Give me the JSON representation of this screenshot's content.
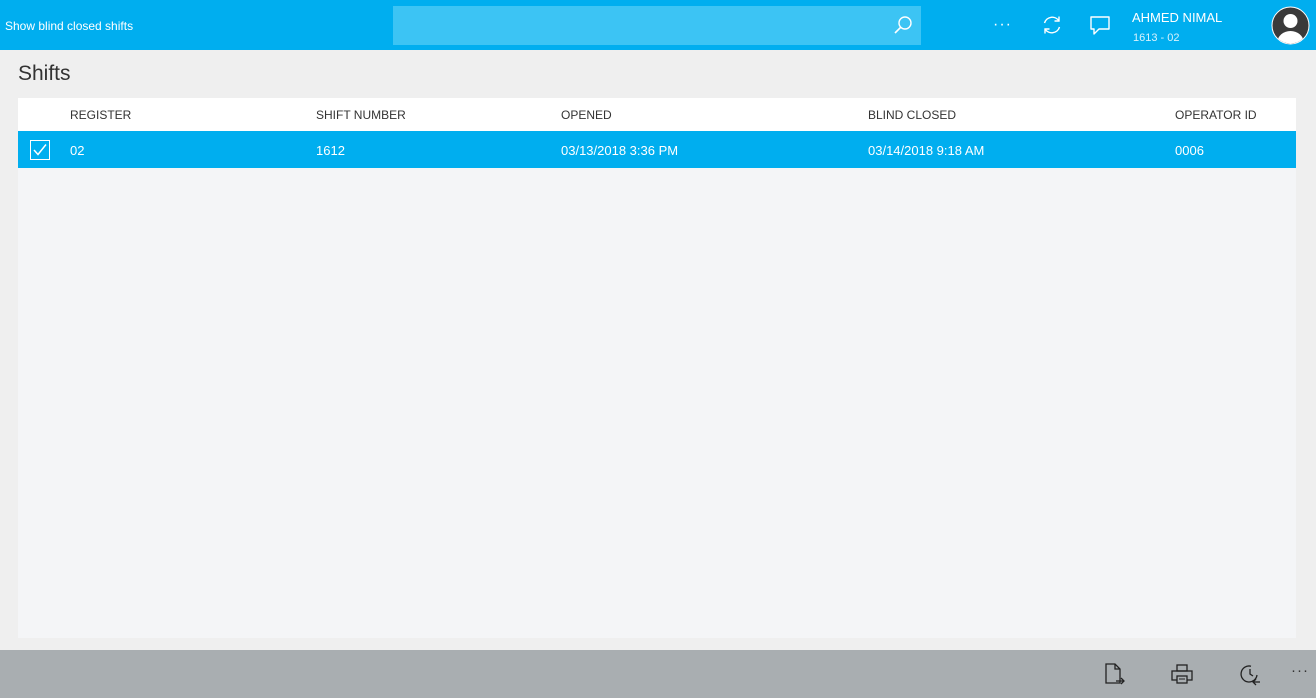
{
  "header": {
    "title": "Show blind closed shifts",
    "search_value": "",
    "more_label": "···",
    "user_name": "AHMED NIMAL",
    "user_sub": "1613 - 02"
  },
  "page": {
    "title": "Shifts"
  },
  "table": {
    "columns": [
      "REGISTER",
      "SHIFT NUMBER",
      "OPENED",
      "BLIND CLOSED",
      "OPERATOR ID"
    ],
    "rows": [
      {
        "selected": true,
        "register": "02",
        "shift_number": "1612",
        "opened": "03/13/2018 3:36 PM",
        "blind_closed": "03/14/2018 9:18 AM",
        "operator_id": "0006"
      }
    ]
  },
  "footer": {
    "more_label": "···"
  },
  "colors": {
    "accent": "#00aeef",
    "bottom_bar": "#a9aeb1"
  }
}
